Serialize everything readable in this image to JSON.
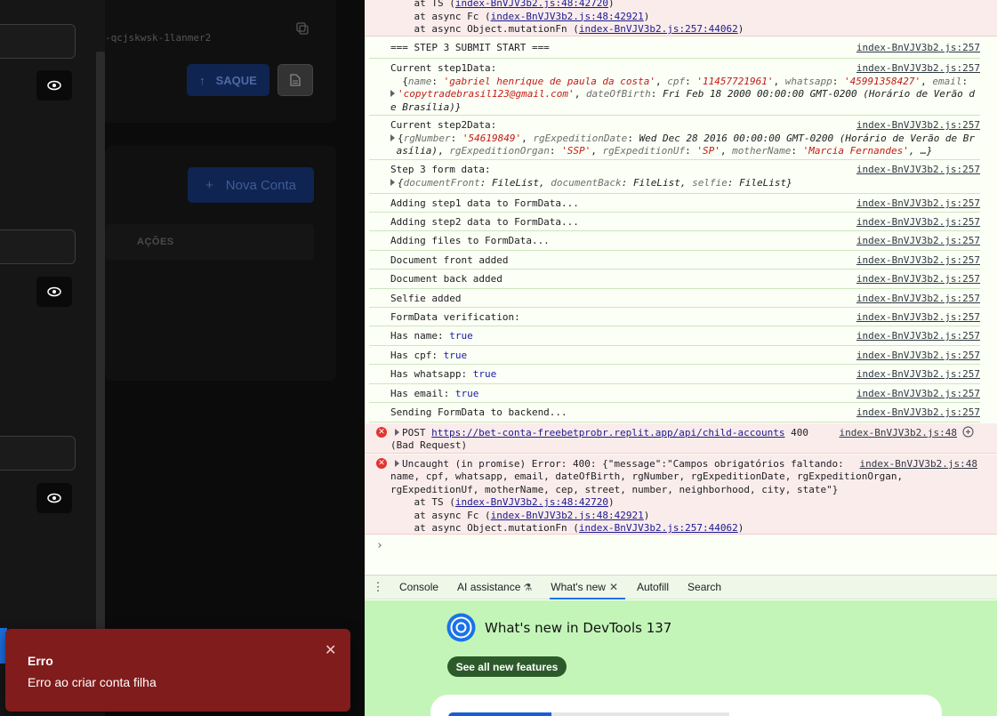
{
  "app": {
    "account_id_fragment": "-qcjskwsk-1lanmer2",
    "saque_label": "SAQUE",
    "nova_conta_label": "Nova Conta",
    "table_actions_header": "AÇÕES",
    "toast": {
      "title": "Erro",
      "description": "Erro ao criar conta filha",
      "close_glyph": "✕"
    }
  },
  "console": {
    "top_error_tail": [
      "    at TS (",
      "index-BnVJV3b2.js:48:42720",
      ")",
      "    at async Fc (",
      "index-BnVJV3b2.js:48:42921",
      ")",
      "    at async Object.mutationFn (",
      "index-BnVJV3b2.js:257:44062",
      ")"
    ],
    "source_257": "index-BnVJV3b2.js:257",
    "source_48": "index-BnVJV3b2.js:48",
    "step3_start": "=== STEP 3 SUBMIT START ===",
    "step1_label": "Current step1Data:",
    "step1": {
      "k_name": "name",
      "v_name": "'gabriel henrique de paula da costa'",
      "k_cpf": "cpf",
      "v_cpf": "'11457721961'",
      "k_whatsapp": "whatsapp",
      "v_whatsapp": "'45991358427'",
      "k_email": "email",
      "v_email": "'copytradebrasil123@gmail.com'",
      "k_dob": "dateOfBirth",
      "v_dob_a": "Fri Feb 18 2000 00:00:00 GMT-0200 (Horário de Verão d",
      "v_dob_b": "e Brasília)}"
    },
    "step2_label": "Current step2Data:",
    "step2": {
      "k_rg": "rgNumber",
      "v_rg": "'54619849'",
      "k_rgdate": "rgExpeditionDate",
      "v_rgdate_a": "Wed Dec 28 2016 00:00:00 GMT-0200 (Horário de Verão de Br",
      "v_rgdate_b": "asília)",
      "k_organ": "rgExpeditionOrgan",
      "v_organ": "'SSP'",
      "k_uf": "rgExpeditionUf",
      "v_uf": "'SP'",
      "k_mother": "motherName",
      "v_mother": "'Marcia Fernandes'",
      "ellipsis": ", …}"
    },
    "step3_label": "Step 3 form data:",
    "step3": {
      "k_front": "documentFront",
      "v_front": "FileList",
      "k_back": "documentBack",
      "v_back": "FileList",
      "k_selfie": "selfie",
      "v_selfie": "FileList"
    },
    "lines": [
      "Adding step1 data to FormData...",
      "Adding step2 data to FormData...",
      "Adding files to FormData...",
      "Document front added",
      "Document back added",
      "Selfie added",
      "FormData verification:"
    ],
    "has": [
      {
        "label": "Has name:",
        "value": "true"
      },
      {
        "label": "Has cpf:",
        "value": "true"
      },
      {
        "label": "Has whatsapp:",
        "value": "true"
      },
      {
        "label": "Has email:",
        "value": "true"
      }
    ],
    "sending": "Sending FormData to backend...",
    "post_error": {
      "method": "POST",
      "url": "https://bet-conta-freebetprobr.replit.app/api/child-accounts",
      "status": "400",
      "status_text": "(Bad Request)"
    },
    "uncaught": {
      "line1": "Uncaught (in promise) Error: 400: {\"message\":\"Campos obrigatórios faltando:",
      "line2": "name, cpf, whatsapp, email, dateOfBirth, rgNumber, rgExpeditionDate, rgExpeditionOrgan,",
      "line3": "rgExpeditionUf, motherName, cep, street, number, neighborhood, city, state\"}",
      "stack1_pre": "    at TS (",
      "stack1_link": "index-BnVJV3b2.js:48:42720",
      "stack2_pre": "    at async Fc (",
      "stack2_link": "index-BnVJV3b2.js:48:42921",
      "stack3_pre": "    at async Object.mutationFn (",
      "stack3_link": "index-BnVJV3b2.js:257:44062",
      "close_paren": ")"
    },
    "prompt_glyph": "›"
  },
  "drawer": {
    "tabs": [
      {
        "label": "Console"
      },
      {
        "label": "AI assistance"
      },
      {
        "label": "What's new"
      },
      {
        "label": "Autofill"
      },
      {
        "label": "Search"
      }
    ],
    "close_glyph": "✕",
    "kebab_glyph": "⋮"
  },
  "whats_new": {
    "title": "What's new in DevTools 137",
    "button": "See all new features"
  },
  "colors": {
    "toast_bg": "#811c1c",
    "console_bg": "#fbfff5",
    "whats_new_bg": "#c3f5b8",
    "error_row_bg": "#fbecec",
    "accent_blue": "#1a73e8"
  }
}
